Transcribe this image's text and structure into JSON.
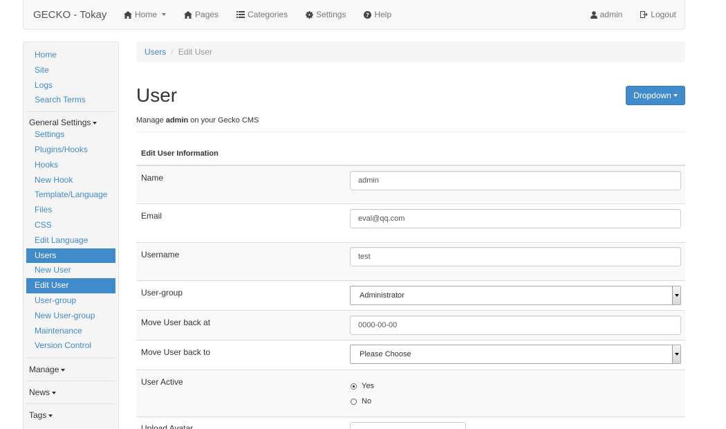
{
  "navbar": {
    "brand": "GECKO - Tokay",
    "items": [
      {
        "label": "Home",
        "icon": "home-icon",
        "caret": true
      },
      {
        "label": "Pages",
        "icon": "pages-icon",
        "caret": false
      },
      {
        "label": "Categories",
        "icon": "list-icon",
        "caret": false
      },
      {
        "label": "Settings",
        "icon": "gear-icon",
        "caret": false
      },
      {
        "label": "Help",
        "icon": "help-icon",
        "caret": false
      }
    ],
    "user_label": "admin",
    "logout_label": "Logout"
  },
  "sidebar": {
    "top_links": [
      "Home",
      "Site",
      "Logs",
      "Search Terms"
    ],
    "general_settings_header": "General Settings",
    "general_links": [
      "Settings",
      "Plugins/Hooks",
      "Hooks",
      "New Hook",
      "Template/Language",
      "Files",
      "CSS",
      "Edit Language",
      "Users",
      "New User",
      "Edit User",
      "User-group",
      "New User-group",
      "Maintenance",
      "Version Control"
    ],
    "active_links": [
      "Users",
      "Edit User"
    ],
    "manage_header": "Manage",
    "news_header": "News",
    "tags_header": "Tags"
  },
  "breadcrumb": {
    "parent": "Users",
    "separator": "/",
    "current": "Edit User"
  },
  "page": {
    "title": "User",
    "dropdown_label": "Dropdown",
    "subtitle_prefix": "Manage",
    "subtitle_user": "admin",
    "subtitle_suffix": "on your Gecko CMS"
  },
  "form": {
    "section_title": "Edit User Information",
    "name_label": "Name",
    "name_value": "admin",
    "email_label": "Email",
    "email_value": "eval@qq.com",
    "username_label": "Username",
    "username_value": "test",
    "usergroup_label": "User-group",
    "usergroup_value": "Administrator",
    "move_back_at_label": "Move User back at",
    "move_back_at_value": "0000-00-00",
    "move_back_to_label": "Move User back to",
    "move_back_to_value": "Please Choose",
    "active_label": "User Active",
    "active_yes": "Yes",
    "active_no": "No",
    "active_selected": "Yes",
    "avatar_label": "Upload Avatar"
  },
  "colors": {
    "link": "#428bca",
    "active_bg": "#428bca",
    "button_bg": "#428bca"
  }
}
